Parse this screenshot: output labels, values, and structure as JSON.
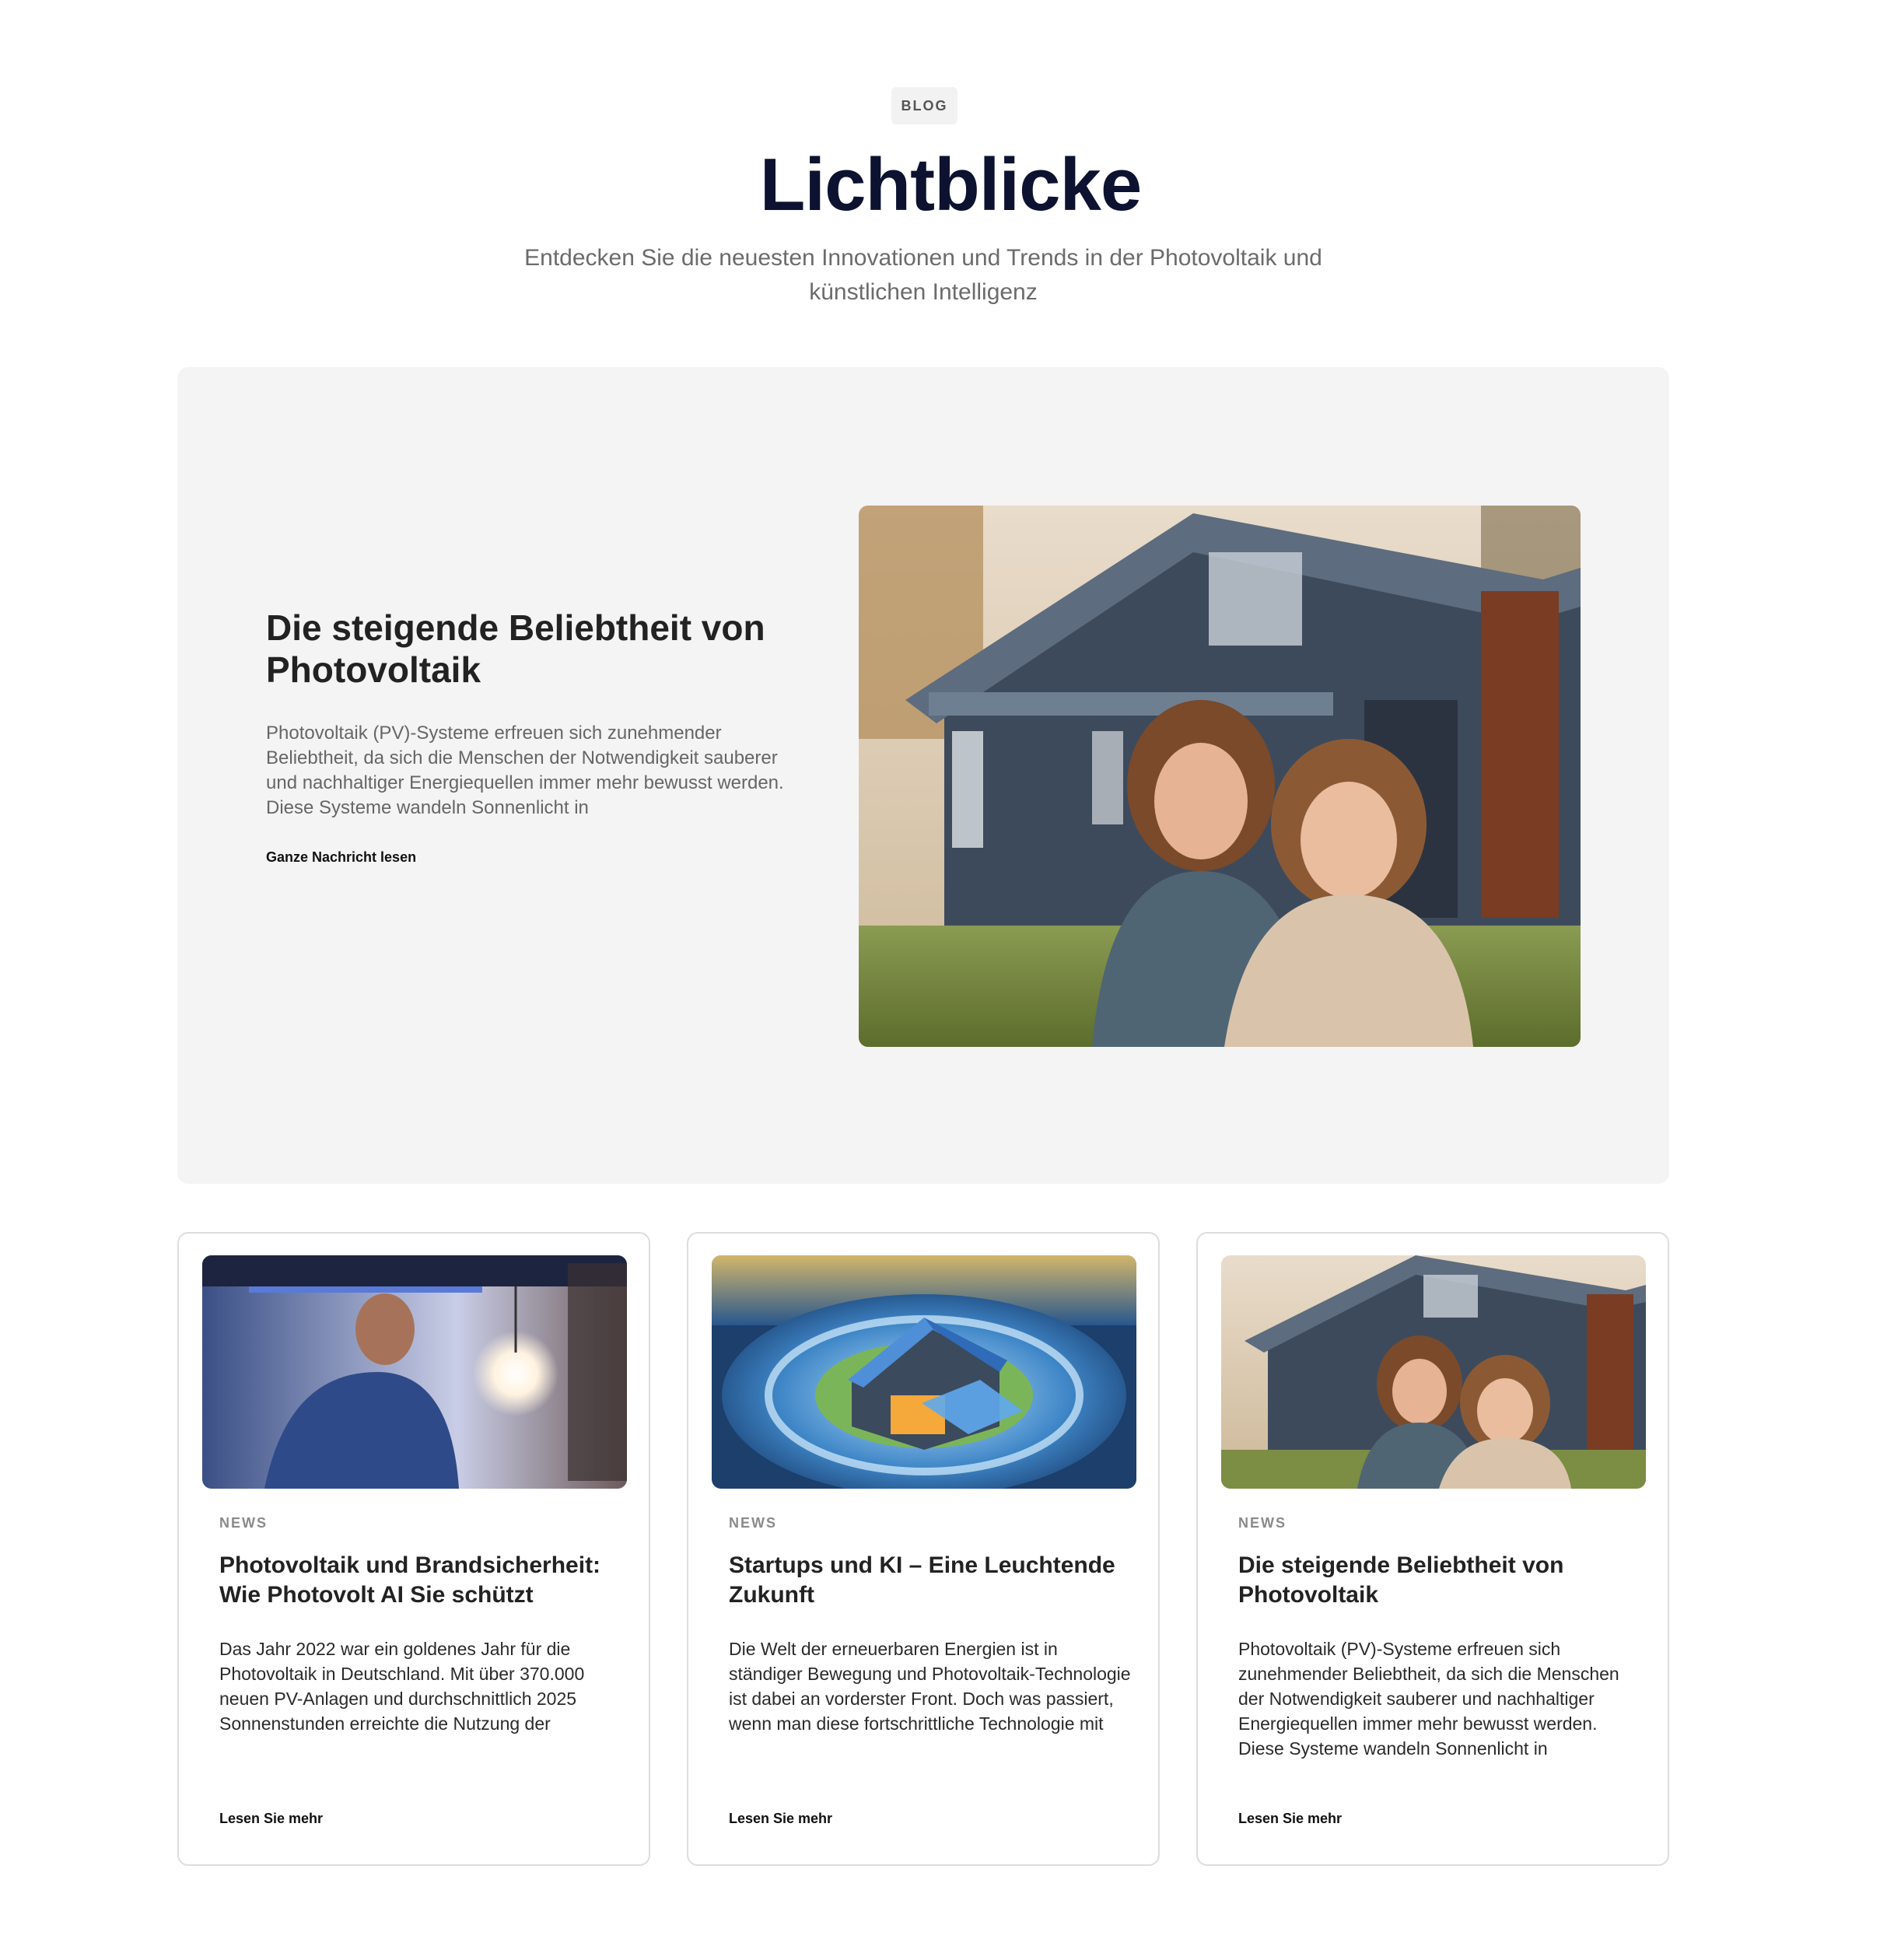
{
  "header": {
    "badge": "BLOG",
    "title": "Lichtblicke",
    "subtitle": "Entdecken Sie die neuesten Innovationen und Trends in der Photovoltaik und künstlichen Intelligenz"
  },
  "featured": {
    "title": "Die steigende Beliebtheit von Photovoltaik",
    "excerpt": "Photovoltaik (PV)-Systeme erfreuen sich zunehmender Beliebtheit, da sich die Menschen der Notwendigkeit sauberer und nachhaltiger Energiequellen immer mehr bewusst werden. Diese Systeme wandeln Sonnenlicht in",
    "link_label": "Ganze Nachricht lesen"
  },
  "cards": [
    {
      "category": "NEWS",
      "title": "Photovoltaik und Brandsicherheit: Wie Photovolt AI Sie schützt",
      "excerpt": "Das Jahr 2022 war ein goldenes Jahr für die Photovoltaik in Deutschland. Mit über 370.000 neuen PV-Anlagen und durchschnittlich 2025 Sonnenstunden erreichte die Nutzung der",
      "link_label": "Lesen Sie mehr"
    },
    {
      "category": "NEWS",
      "title": "Startups und KI – Eine Leuchtende Zukunft",
      "excerpt": "Die Welt der erneuerbaren Energien ist in ständiger Bewegung und Photovoltaik-Technologie ist dabei an vorderster Front. Doch was passiert, wenn man diese fortschrittliche Technologie mit",
      "link_label": "Lesen Sie mehr"
    },
    {
      "category": "NEWS",
      "title": "Die steigende Beliebtheit von Photovoltaik",
      "excerpt": "Photovoltaik (PV)-Systeme erfreuen sich zunehmender Beliebtheit, da sich die Menschen der Notwendigkeit sauberer und nachhaltiger Energiequellen immer mehr bewusst werden. Diese Systeme wandeln Sonnenlicht in",
      "link_label": "Lesen Sie mehr"
    }
  ],
  "colors": {
    "title": "#0d1230",
    "featured_bg": "#f4f4f4",
    "card_border": "#dddddd",
    "muted_text": "#6b6b6b"
  }
}
